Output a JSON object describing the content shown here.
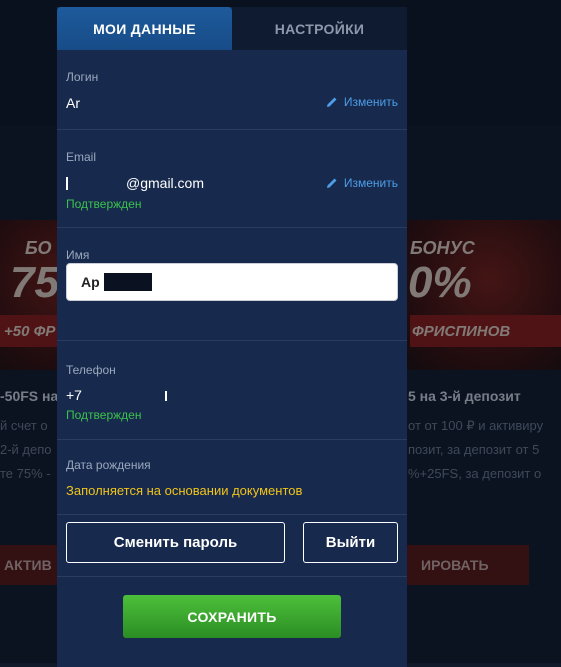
{
  "tabs": {
    "profile": "МОИ ДАННЫЕ",
    "settings": "НАСТРОЙКИ"
  },
  "login": {
    "label": "Логин",
    "value": "Ar",
    "edit_label": "Изменить"
  },
  "email": {
    "label": "Email",
    "value": "@gmail.com",
    "status": "Подтвержден",
    "edit_label": "Изменить"
  },
  "name": {
    "label": "Имя",
    "value": "Ар"
  },
  "phone": {
    "label": "Телефон",
    "value": "+7",
    "status": "Подтвержден"
  },
  "birthdate": {
    "label": "Дата рождения",
    "note": "Заполняется на основании документов"
  },
  "actions": {
    "change_password": "Сменить пароль",
    "logout": "Выйти",
    "save": "СОХРАНИТЬ"
  },
  "background": {
    "promo_left_big": "75",
    "promo_left_top": "БО",
    "promo_left_sub": "+50 ФР",
    "promo_right_top": "БОНУС",
    "promo_right_big": "0%",
    "promo_right_sub": "ФРИСПИНОВ",
    "line1_left": "-50FS на",
    "line1_right": "5 на 3-й депозит",
    "line2_left": "й счет о",
    "line2_right": "от от 100 ₽ и активиру",
    "line3_left": "2-й депо",
    "line3_right": "позит, за депозит от 5",
    "line4_left": "те 75% -",
    "line4_right": "%+25FS, за депозит о",
    "btn_left": "АКТИВ",
    "btn_right": "ИРОВАТЬ"
  },
  "colors": {
    "modal_bg": "#172a4d",
    "active_tab": "#1e5a9c",
    "link": "#4d9de8",
    "verified": "#3cc14c",
    "note": "#f0c419",
    "save_button": "#3aa82f"
  }
}
